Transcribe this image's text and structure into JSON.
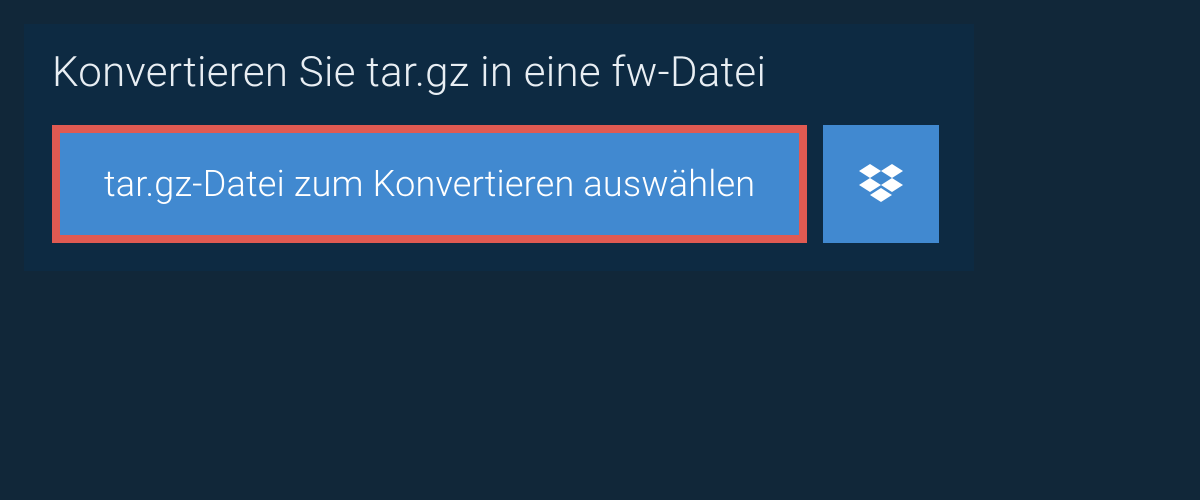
{
  "card": {
    "title": "Konvertieren Sie tar.gz in eine fw-Datei"
  },
  "buttons": {
    "select_file_label": "tar.gz-Datei zum Konvertieren auswählen"
  },
  "colors": {
    "page_bg": "#112739",
    "card_bg": "#0d2a42",
    "button_bg": "#4189d0",
    "highlight_border": "#e05a52",
    "text_light": "#e8eef3",
    "text_white": "#ffffff"
  }
}
